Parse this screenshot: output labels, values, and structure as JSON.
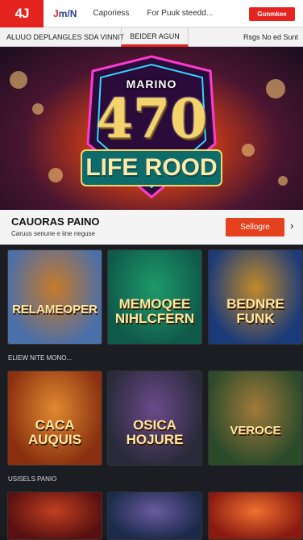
{
  "topbar": {
    "logo": "4J",
    "brand2_a": "J",
    "brand2_b": "m/N",
    "categories": "Caporiess",
    "search": "For Puuk steedd...",
    "button": "Gunmkee"
  },
  "subbar": {
    "left": "ALUUO DEPLANGLES SDA VINNIT",
    "center": "BEIDER AGUN",
    "right": "Rsgs No ed Sunt"
  },
  "hero": {
    "subtitle": "MARINO",
    "number": "470",
    "title": "LIFE ROOD"
  },
  "section": {
    "title": "CAUORAS PAINO",
    "subtitle": "Caruus senune e iine neguse",
    "button": "Sellogre",
    "arrow": "›"
  },
  "rows": [
    {
      "label": "",
      "tiles": [
        {
          "title": "RELAMEOPER",
          "colors": [
            "#4b6fa8",
            "#c77a2a"
          ]
        },
        {
          "title": "MEMOQEE NIHLCFERN",
          "colors": [
            "#0f5a4a",
            "#1e9a6a"
          ]
        },
        {
          "title": "BEDNRE FUNK",
          "colors": [
            "#1a3a7a",
            "#c08a2a"
          ]
        }
      ]
    },
    {
      "label": "ELIEW NITE MONO...",
      "tiles": [
        {
          "title": "CACA AUQUIS",
          "colors": [
            "#8a3010",
            "#e08a30"
          ]
        },
        {
          "title": "OSICA HOJURE",
          "colors": [
            "#2a2a3a",
            "#6a4a8a"
          ]
        },
        {
          "title": "VEROCE",
          "colors": [
            "#2a4a2a",
            "#a07a3a"
          ]
        }
      ]
    },
    {
      "label": "USISELS PANIO",
      "tiles": [
        {
          "title": "",
          "colors": [
            "#5a1010",
            "#c04020"
          ]
        },
        {
          "title": "",
          "colors": [
            "#1a2a4a",
            "#6a5aa0"
          ]
        },
        {
          "title": "",
          "colors": [
            "#8a1a10",
            "#f07030"
          ]
        }
      ]
    }
  ]
}
